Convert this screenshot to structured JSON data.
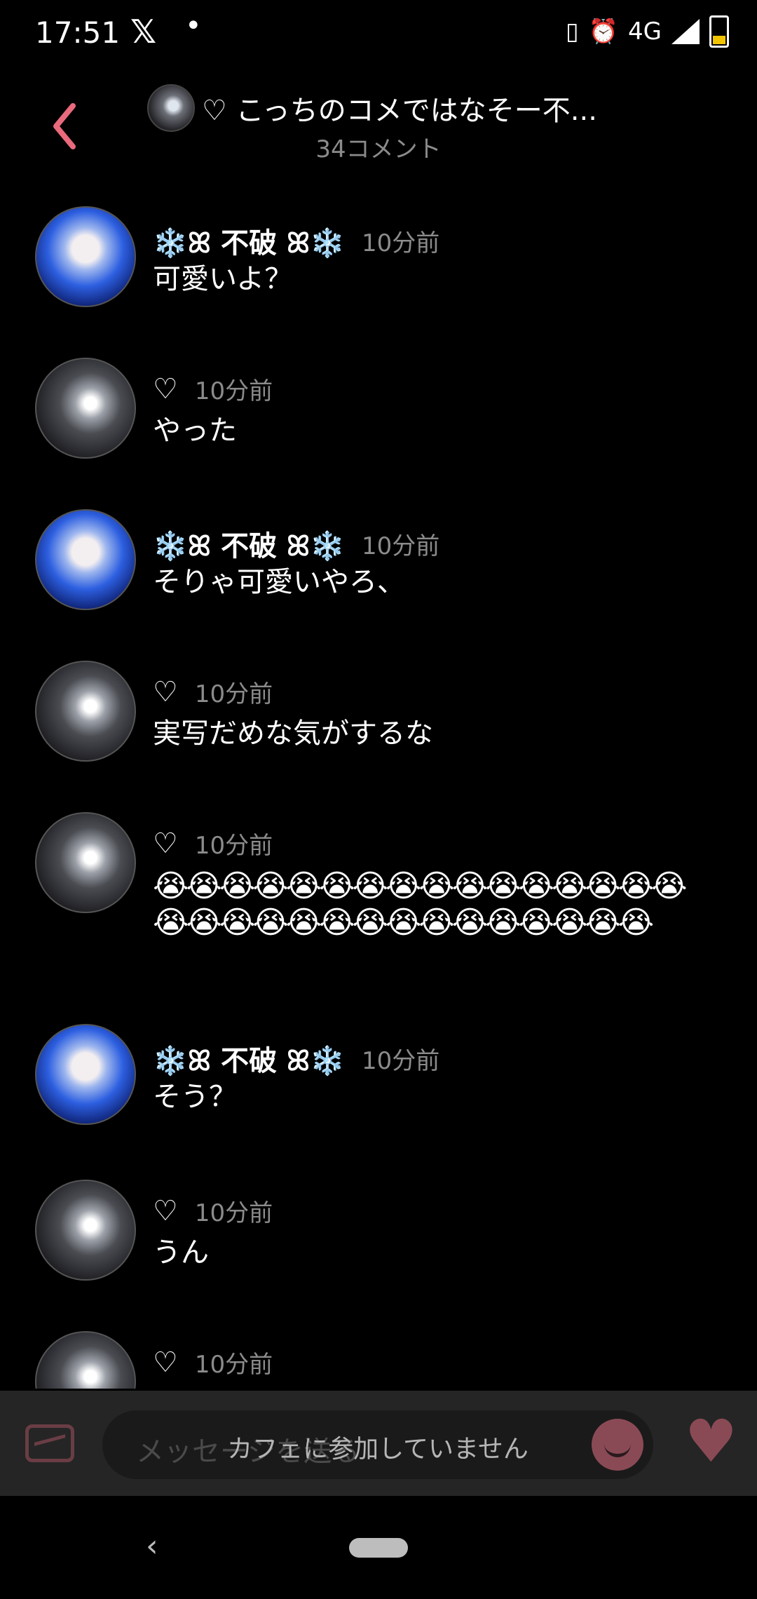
{
  "status_bar": {
    "time": "17:51",
    "network": "4G",
    "x_app": "𝕏",
    "dot": "•"
  },
  "header": {
    "title": "♡ こっちのコメではなそー不...",
    "subtitle": "34コメント"
  },
  "comments": [
    {
      "name": "❄️ꕤ 不破 ꕤ❄️",
      "time": "10分前",
      "text": "可愛いよ？",
      "avatar": "girl"
    },
    {
      "name": "♡",
      "time": "10分前",
      "text": "やった",
      "avatar": "phone"
    },
    {
      "name": "❄️ꕤ 不破 ꕤ❄️",
      "time": "10分前",
      "text": "そりゃ可愛いやろ、",
      "avatar": "girl"
    },
    {
      "name": "♡",
      "time": "10分前",
      "text": "実写だめな気がするな",
      "avatar": "phone"
    },
    {
      "name": "♡",
      "time": "10分前",
      "text": "😭😭😭😭😭😭😭😭😭😭😭😭😭😭😭😭😭😭😭😭😭😭😭😭😭😭😭😭😭😭😭",
      "avatar": "phone"
    },
    {
      "name": "❄️ꕤ 不破 ꕤ❄️",
      "time": "10分前",
      "text": "そう？",
      "avatar": "girl"
    },
    {
      "name": "♡",
      "time": "10分前",
      "text": "うん",
      "avatar": "phone"
    },
    {
      "name": "♡",
      "time": "10分前",
      "text": "",
      "avatar": "phone"
    }
  ],
  "input": {
    "placeholder": "メッセージを送る",
    "not_joined": "カフェに参加していません"
  },
  "colors": {
    "accent": "#e86a7c",
    "muted": "#8b8b8b",
    "bar": "#252525"
  }
}
